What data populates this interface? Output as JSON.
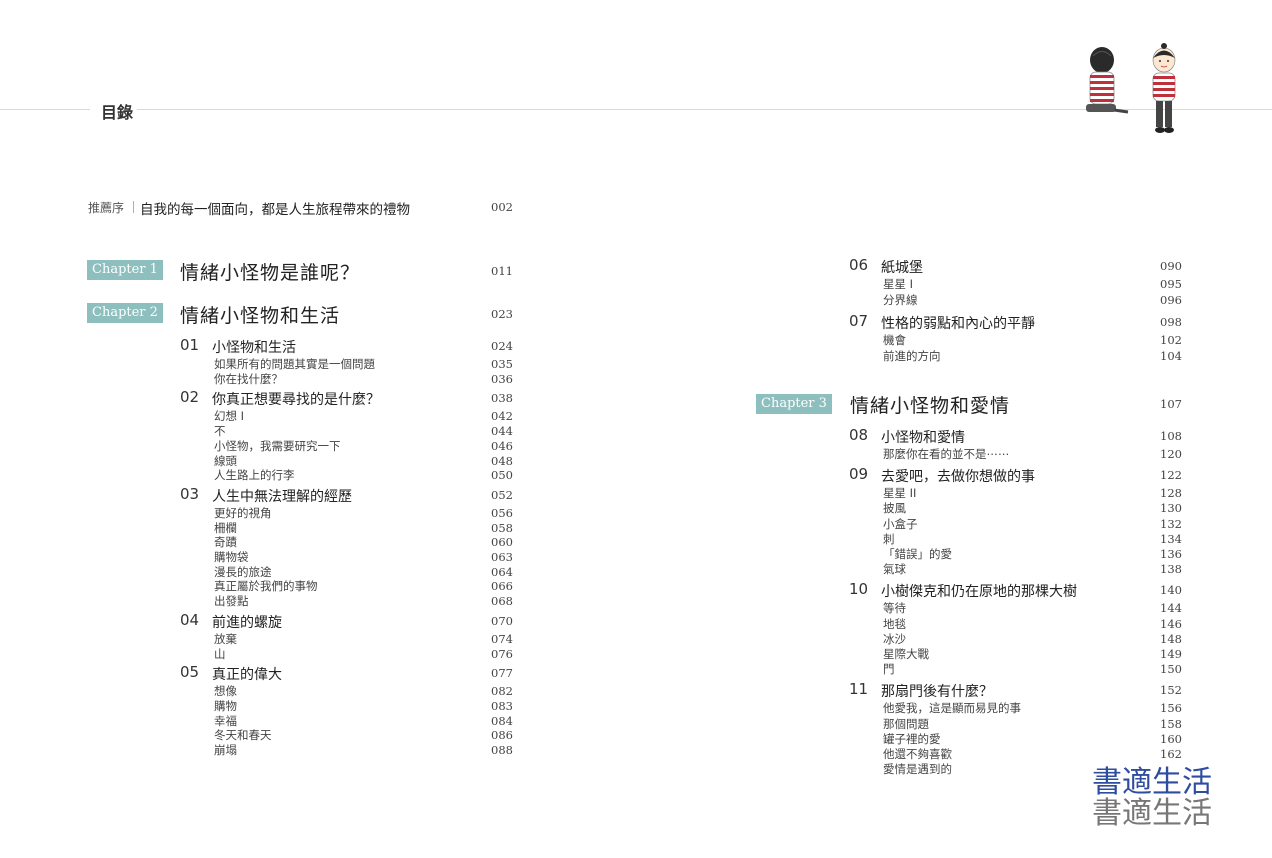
{
  "header": {
    "title": "目錄"
  },
  "preface": {
    "label": "推薦序",
    "title": "自我的每一個面向，都是人生旅程帶來的禮物",
    "page": "002"
  },
  "left": {
    "chapters": [
      {
        "badge": "Chapter 1",
        "title": "情緒小怪物是誰呢？",
        "page": "011"
      },
      {
        "badge": "Chapter 2",
        "title": "情緒小怪物和生活",
        "page": "023"
      }
    ],
    "sections": [
      {
        "num": "01",
        "title": "小怪物和生活",
        "page": "024",
        "items": [
          {
            "title": "如果所有的問題其實是一個問題",
            "page": "035"
          },
          {
            "title": "你在找什麼？",
            "page": "036"
          }
        ]
      },
      {
        "num": "02",
        "title": "你真正想要尋找的是什麼？",
        "page": "038",
        "items": [
          {
            "title": "幻想 I",
            "page": "042"
          },
          {
            "title": "不",
            "page": "044"
          },
          {
            "title": "小怪物，我需要研究一下",
            "page": "046"
          },
          {
            "title": "線頭",
            "page": "048"
          },
          {
            "title": "人生路上的行李",
            "page": "050"
          }
        ]
      },
      {
        "num": "03",
        "title": "人生中無法理解的經歷",
        "page": "052",
        "items": [
          {
            "title": "更好的視角",
            "page": "056"
          },
          {
            "title": "柵欄",
            "page": "058"
          },
          {
            "title": "奇蹟",
            "page": "060"
          },
          {
            "title": "購物袋",
            "page": "063"
          },
          {
            "title": "漫長的旅途",
            "page": "064"
          },
          {
            "title": "真正屬於我們的事物",
            "page": "066"
          },
          {
            "title": "出發點",
            "page": "068"
          }
        ]
      },
      {
        "num": "04",
        "title": "前進的螺旋",
        "page": "070",
        "items": [
          {
            "title": "放棄",
            "page": "074"
          },
          {
            "title": "山",
            "page": "076"
          }
        ]
      },
      {
        "num": "05",
        "title": "真正的偉大",
        "page": "077",
        "items": [
          {
            "title": "想像",
            "page": "082"
          },
          {
            "title": "購物",
            "page": "083"
          },
          {
            "title": "幸福",
            "page": "084"
          },
          {
            "title": "冬天和春天",
            "page": "086"
          },
          {
            "title": "崩塌",
            "page": "088"
          }
        ]
      }
    ]
  },
  "right": {
    "sections_a": [
      {
        "num": "06",
        "title": "紙城堡",
        "page": "090",
        "items": [
          {
            "title": "星星 I",
            "page": "095"
          },
          {
            "title": "分界線",
            "page": "096"
          }
        ]
      },
      {
        "num": "07",
        "title": "性格的弱點和內心的平靜",
        "page": "098",
        "items": [
          {
            "title": "機會",
            "page": "102"
          },
          {
            "title": "前進的方向",
            "page": "104"
          }
        ]
      }
    ],
    "chapter": {
      "badge": "Chapter 3",
      "title": "情緒小怪物和愛情",
      "page": "107"
    },
    "sections_b": [
      {
        "num": "08",
        "title": "小怪物和愛情",
        "page": "108",
        "items": [
          {
            "title": "那麼你在看的並不是⋯⋯",
            "page": "120"
          }
        ]
      },
      {
        "num": "09",
        "title": "去愛吧，去做你想做的事",
        "page": "122",
        "items": [
          {
            "title": "星星 II",
            "page": "128"
          },
          {
            "title": "披風",
            "page": "130"
          },
          {
            "title": "小盒子",
            "page": "132"
          },
          {
            "title": "刺",
            "page": "134"
          },
          {
            "title": "「錯誤」的愛",
            "page": "136"
          },
          {
            "title": "氣球",
            "page": "138"
          }
        ]
      },
      {
        "num": "10",
        "title": "小樹傑克和仍在原地的那棵大樹",
        "page": "140",
        "items": [
          {
            "title": "等待",
            "page": "144"
          },
          {
            "title": "地毯",
            "page": "146"
          },
          {
            "title": "冰沙",
            "page": "148"
          },
          {
            "title": "星際大戰",
            "page": "149"
          },
          {
            "title": "門",
            "page": "150"
          }
        ]
      },
      {
        "num": "11",
        "title": "那扇門後有什麼？",
        "page": "152",
        "items": [
          {
            "title": "他愛我，這是顯而易見的事",
            "page": "156"
          },
          {
            "title": "那個問題",
            "page": "158"
          },
          {
            "title": "罐子裡的愛",
            "page": "160"
          },
          {
            "title": "他還不夠喜歡",
            "page": "162"
          },
          {
            "title": "愛情是遇到的",
            "page": ""
          }
        ]
      }
    ]
  },
  "watermark": {
    "text": "書適生活",
    "color_front": "#2f4d9e",
    "color_back": "#777777"
  },
  "colors": {
    "accent": "#8cbfbd",
    "rule": "#cfdedd"
  },
  "illustration": {
    "name": "two-children-sitting-illustration"
  }
}
